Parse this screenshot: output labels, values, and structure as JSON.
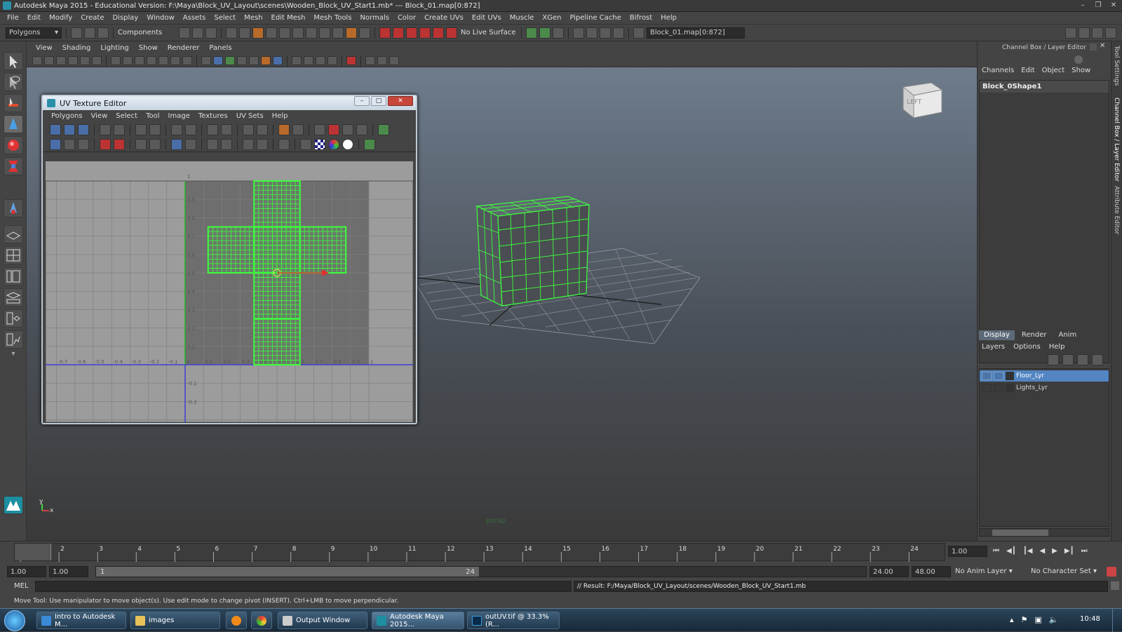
{
  "window": {
    "title": "Autodesk Maya 2015 - Educational Version: F:\\Maya\\Block_UV_Layout\\scenes\\Wooden_Block_UV_Start1.mb*   ---   Block_01.map[0:872]"
  },
  "menubar": [
    "File",
    "Edit",
    "Modify",
    "Create",
    "Display",
    "Window",
    "Assets",
    "Select",
    "Mesh",
    "Edit Mesh",
    "Mesh Tools",
    "Normals",
    "Color",
    "Create UVs",
    "Edit UVs",
    "Muscle",
    "XGen",
    "Pipeline Cache",
    "Bifrost",
    "Help"
  ],
  "statusline": {
    "mode": "Polygons",
    "components": "Components",
    "live_surface": "No Live Surface",
    "selection_field": "Block_01.map[0:872]"
  },
  "viewport": {
    "menu": [
      "View",
      "Shading",
      "Lighting",
      "Show",
      "Renderer",
      "Panels"
    ],
    "camera_label": "persp",
    "viewcube_label": "LEFT",
    "axis_y": "y",
    "axis_x": "x"
  },
  "uv_editor": {
    "title": "UV Texture Editor",
    "menu": [
      "Polygons",
      "View",
      "Select",
      "Tool",
      "Image",
      "Textures",
      "UV Sets",
      "Help"
    ],
    "u_ticks": [
      "-0.7",
      "-0.6",
      "-0.5",
      "-0.4",
      "-0.3",
      "-0.2",
      "-0.1",
      "0",
      "0.1",
      "0.2",
      "0.3",
      "0.4",
      "0.5",
      "0.6",
      "0.7",
      "0.8",
      "0.9",
      "1"
    ],
    "v_ticks": [
      "1",
      "0.9",
      "0.8",
      "0.7",
      "0.6",
      "0.5",
      "0.4",
      "0.3",
      "0.2",
      "0.1",
      "-0.1",
      "-0.2"
    ]
  },
  "channel_box": {
    "title": "Channel Box / Layer Editor",
    "menu": [
      "Channels",
      "Edit",
      "Object",
      "Show"
    ],
    "object": "Block_0Shape1",
    "side_tabs": [
      "Tool Settings",
      "Channel Box / Layer Editor",
      "Attribute Editor"
    ],
    "layer_tabs": [
      "Display",
      "Render",
      "Anim"
    ],
    "layer_menu": [
      "Layers",
      "Options",
      "Help"
    ],
    "layers": [
      {
        "name": "Floor_Lyr",
        "selected": true
      },
      {
        "name": "Lights_Lyr",
        "selected": false
      }
    ]
  },
  "timeline": {
    "ticks": [
      "1",
      "2",
      "3",
      "4",
      "5",
      "6",
      "7",
      "8",
      "9",
      "10",
      "11",
      "12",
      "13",
      "14",
      "15",
      "16",
      "17",
      "18",
      "19",
      "20",
      "21",
      "22",
      "23",
      "24"
    ],
    "current_frame": "1.00"
  },
  "range": {
    "start": "1.00",
    "start2": "1.00",
    "slider_start": "1",
    "slider_end": "24",
    "end": "24.00",
    "end2": "48.00",
    "anim_layer": "No Anim Layer",
    "char_set": "No Character Set"
  },
  "cmdline": {
    "label": "MEL",
    "result": "// Result: F:/Maya/Block_UV_Layout/scenes/Wooden_Block_UV_Start1.mb"
  },
  "helpline": "Move Tool: Use manipulator to move object(s). Use edit mode to change pivot (INSERT). Ctrl+LMB to move perpendicular.",
  "taskbar": {
    "items": [
      "Intro to Autodesk M...",
      "images",
      "",
      "",
      "Output Window",
      "Autodesk Maya 2015...",
      "outUV.tif @ 33.3% (R..."
    ],
    "clock": "10:48"
  }
}
